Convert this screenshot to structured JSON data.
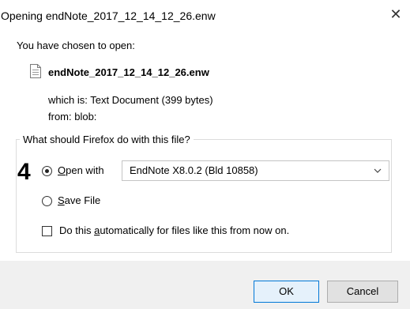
{
  "window": {
    "title": "Opening endNote_2017_12_14_12_26.enw",
    "close_symbol": "✕"
  },
  "intro": {
    "chosen_label": "You have chosen to open:"
  },
  "file": {
    "icon": "document-icon",
    "name": "endNote_2017_12_14_12_26.enw",
    "which_is": "which is:  Text Document (399 bytes)",
    "from": "from:  blob:"
  },
  "action_group": {
    "legend": "What should Firefox do with this file?",
    "step_number": "4",
    "open_with": {
      "label_prefix": "",
      "label_mnemonic": "O",
      "label_rest": "pen with",
      "checked": true
    },
    "application": {
      "selected": "EndNote X8.0.2 (Bld 10858)"
    },
    "save_file": {
      "label_mnemonic": "S",
      "label_rest": "ave File",
      "checked": false
    },
    "auto_checkbox": {
      "label_prefix": "Do this ",
      "label_mnemonic": "a",
      "label_rest": "utomatically for files like this from now on.",
      "checked": false
    }
  },
  "buttons": {
    "ok": "OK",
    "cancel": "Cancel"
  }
}
